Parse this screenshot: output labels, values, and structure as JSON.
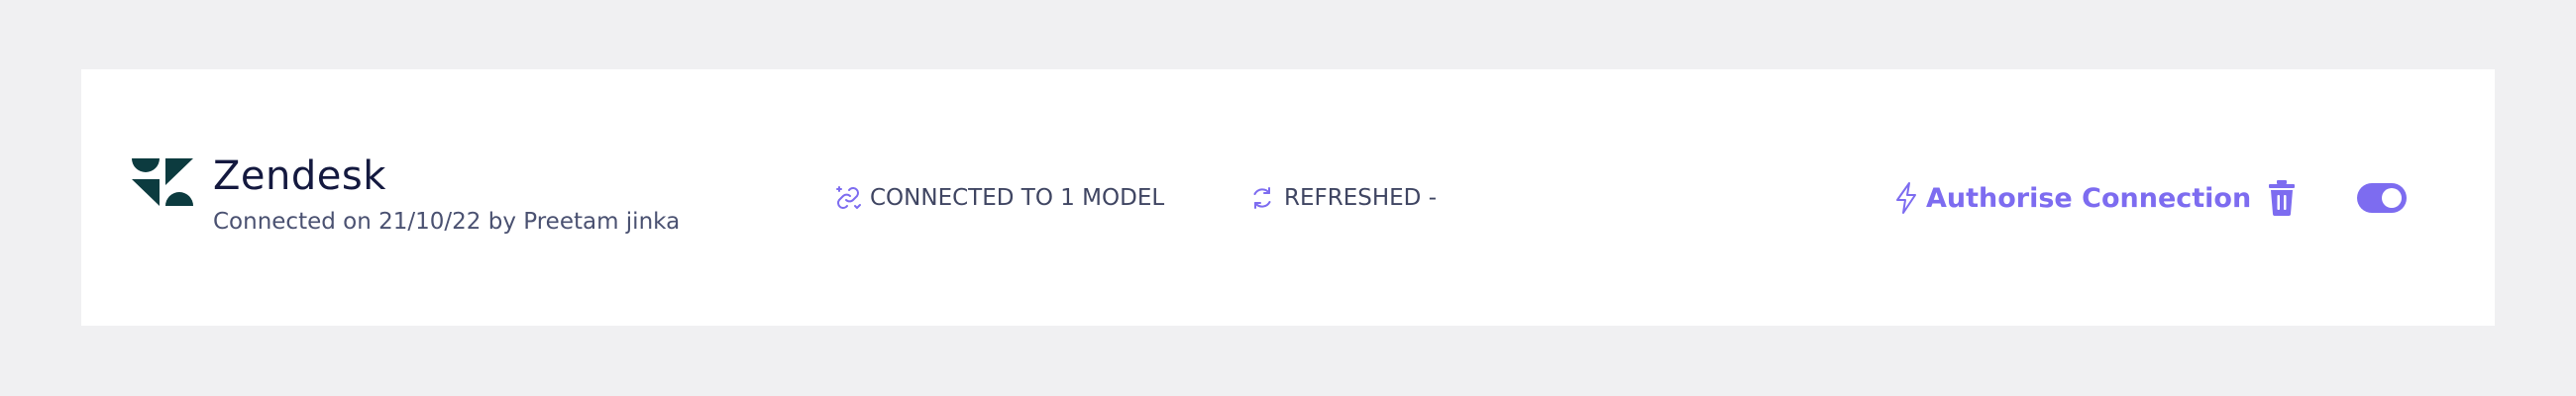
{
  "colors": {
    "accent": "#7d6cf0",
    "logo": "#0c3b3f",
    "page_background": "#f0f0f2"
  },
  "integration": {
    "logo_icon": "zendesk-logo",
    "name": "Zendesk",
    "connected_info": "Connected on 21/10/22 by Preetam jinka"
  },
  "status": {
    "connected_icon": "link-refresh-icon",
    "connected_label": "CONNECTED TO 1 MODEL",
    "refreshed_icon": "refresh-icon",
    "refreshed_label": "REFRESHED -"
  },
  "actions": {
    "authorise_icon": "lightning-bolt-icon",
    "authorise_label": "Authorise Connection",
    "delete_icon": "trash-icon",
    "toggle_state": "on"
  }
}
